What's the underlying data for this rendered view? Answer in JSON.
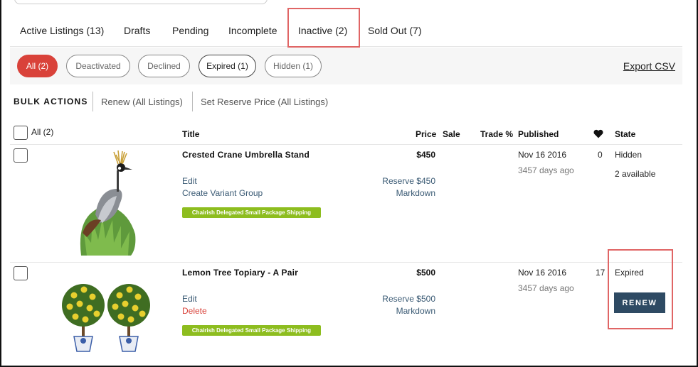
{
  "tabs": [
    {
      "label": "Active Listings (13)"
    },
    {
      "label": "Drafts"
    },
    {
      "label": "Pending"
    },
    {
      "label": "Incomplete"
    },
    {
      "label": "Inactive (2)",
      "selected": true
    },
    {
      "label": "Sold Out (7)"
    }
  ],
  "filters": [
    {
      "label": "All (2)",
      "active": true
    },
    {
      "label": "Deactivated"
    },
    {
      "label": "Declined"
    },
    {
      "label": "Expired (1)"
    },
    {
      "label": "Hidden (1)"
    }
  ],
  "export_label": "Export CSV",
  "bulk": {
    "title": "BULK ACTIONS",
    "actions": [
      "Renew (All Listings)",
      "Set Reserve Price (All Listings)"
    ]
  },
  "table": {
    "select_all_label": "All (2)",
    "headers": {
      "title": "Title",
      "price": "Price",
      "sale": "Sale",
      "trade": "Trade %",
      "published": "Published",
      "favorites_icon": "heart-icon",
      "state": "State"
    },
    "rows": [
      {
        "title": "Crested Crane Umbrella Stand",
        "image": "crested-crane-image",
        "actions": [
          "Edit",
          "Create Variant Group"
        ],
        "badge": "Chairish Delegated Small Package Shipping",
        "price": "$450",
        "reserve": "Reserve $450",
        "markdown": "Markdown",
        "published": "Nov 16 2016",
        "age": "3457 days ago",
        "favorites": "0",
        "state": "Hidden",
        "availability": "2 available"
      },
      {
        "title": "Lemon Tree Topiary - A Pair",
        "image": "lemon-topiary-image",
        "actions": [
          "Edit",
          "Delete"
        ],
        "badge": "Chairish Delegated Small Package Shipping",
        "price": "$500",
        "reserve": "Reserve $500",
        "markdown": "Markdown",
        "published": "Nov 16 2016",
        "age": "3457 days ago",
        "favorites": "17",
        "state": "Expired",
        "renew_label": "RENEW"
      }
    ]
  },
  "colors": {
    "accent": "#d9423a",
    "badge": "#8dbd1f",
    "renew_button": "#2e4a63",
    "highlight": "#e06565",
    "link": "#3a5a74"
  }
}
